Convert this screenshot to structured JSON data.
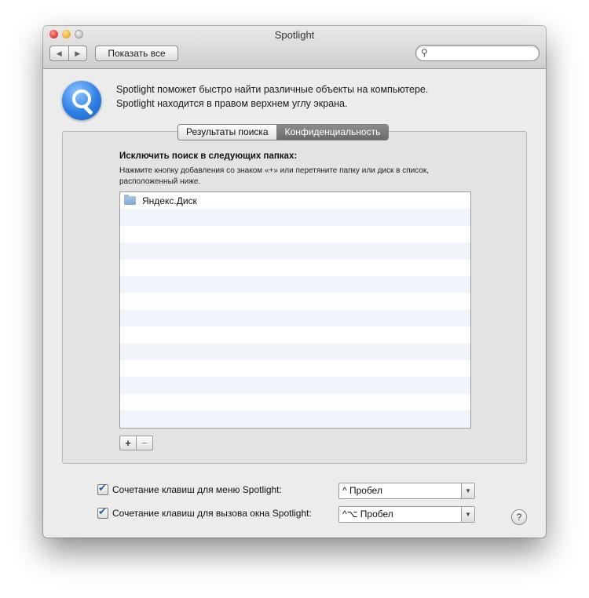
{
  "window": {
    "title": "Spotlight"
  },
  "toolbar": {
    "back_glyph": "◀",
    "forward_glyph": "▶",
    "show_all_label": "Показать все",
    "search_icon": "search-icon",
    "search_value": ""
  },
  "description": {
    "line1": "Spotlight поможет быстро найти различные объекты на компьютере.",
    "line2": "Spotlight находится в правом верхнем углу экрана."
  },
  "tabs": [
    {
      "label": "Результаты поиска",
      "active": false
    },
    {
      "label": "Конфиденциальность",
      "active": true
    }
  ],
  "privacy": {
    "title": "Исключить поиск в следующих папках:",
    "hint": "Нажмите кнопку добавления со знаком «+» или перетяните папку или диск в список, расположенный ниже.",
    "items": [
      {
        "name": "Яндекс.Диск",
        "icon": "folder-icon"
      }
    ],
    "add_label": "+",
    "remove_label": "−"
  },
  "shortcuts": [
    {
      "label": "Сочетание клавиш для меню Spotlight:",
      "checked": true,
      "value": "^ Пробел"
    },
    {
      "label": "Сочетание клавиш для вызова окна Spotlight:",
      "checked": true,
      "value": "^⌥ Пробел"
    }
  ],
  "help": {
    "label": "?"
  },
  "colors": {
    "accent": "#2d7fe6",
    "active_tab": "#7a7a7a",
    "row_stripe": "#f1f4fa"
  }
}
